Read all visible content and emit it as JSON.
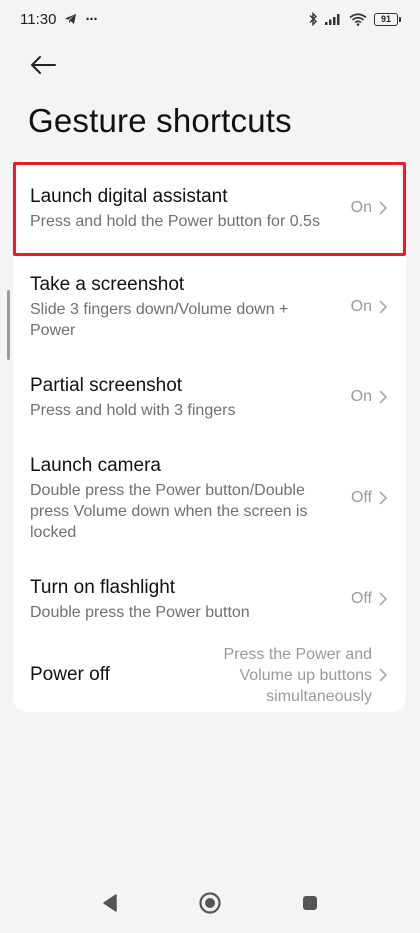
{
  "status": {
    "time": "11:30",
    "more": "···",
    "battery": "91"
  },
  "header": {
    "title": "Gesture shortcuts"
  },
  "items": [
    {
      "title": "Launch digital assistant",
      "desc": "Press and hold the Power button for 0.5s",
      "value": "On"
    },
    {
      "title": "Take a screenshot",
      "desc": "Slide 3 fingers down/Volume down + Power",
      "value": "On"
    },
    {
      "title": "Partial screenshot",
      "desc": "Press and hold with 3 fingers",
      "value": "On"
    },
    {
      "title": "Launch camera",
      "desc": "Double press the Power button/Double press Volume down when the screen is locked",
      "value": "Off"
    },
    {
      "title": "Turn on flashlight",
      "desc": "Double press the Power button",
      "value": "Off"
    },
    {
      "title": "Power off",
      "desc": "",
      "value": "Press the Power and Volume up buttons simultaneously"
    }
  ],
  "colors": {
    "highlight": "#e0202e",
    "background": "#f4f4f4",
    "card": "#ffffff"
  },
  "icons": {
    "back": "arrow-left-icon",
    "chevron": "chevron-right-icon",
    "nav_back": "triangle-back-icon",
    "nav_home": "circle-home-icon",
    "nav_recents": "square-recents-icon"
  }
}
